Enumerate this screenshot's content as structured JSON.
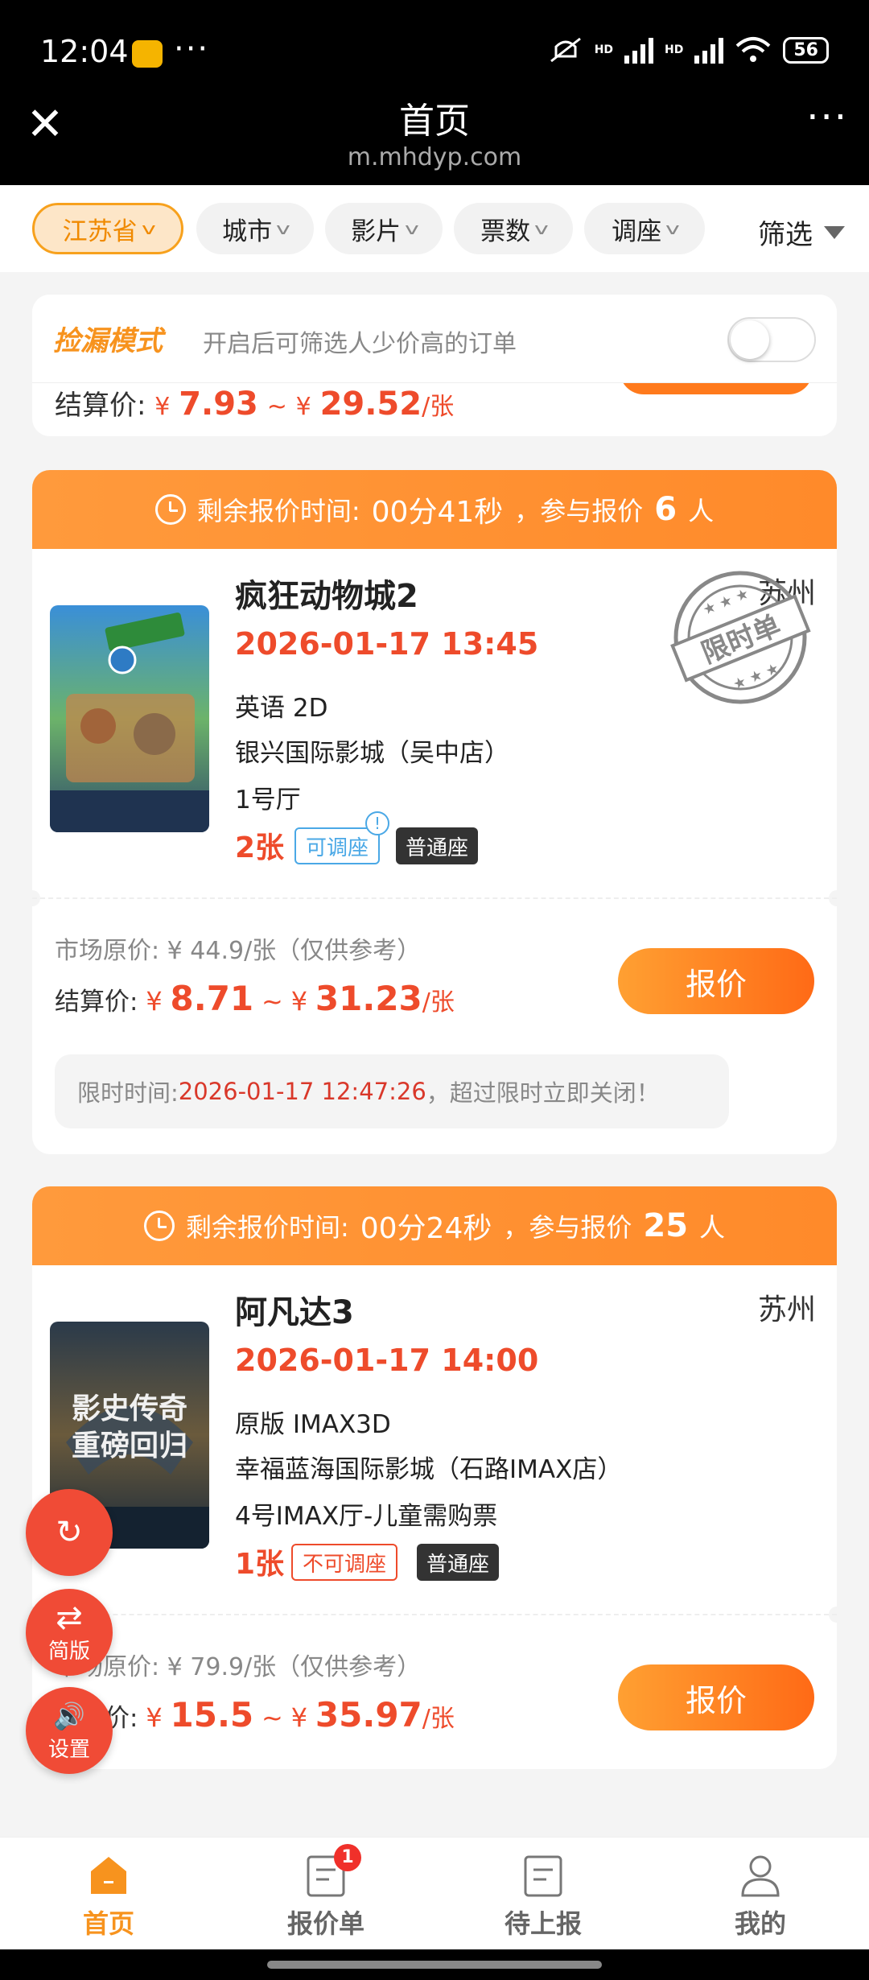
{
  "status_bar": {
    "time": "12:04",
    "more": "···",
    "battery": "56",
    "hd1": "HD",
    "hd2": "HD"
  },
  "header": {
    "title": "首页",
    "url": "m.mhdyp.com",
    "close": "✕",
    "more": "···"
  },
  "filters": {
    "chips": [
      {
        "label": "江苏省",
        "active": true
      },
      {
        "label": "城市",
        "active": false
      },
      {
        "label": "影片",
        "active": false
      },
      {
        "label": "票数",
        "active": false
      },
      {
        "label": "调座",
        "active": false
      }
    ],
    "filter_label": "筛选"
  },
  "mode": {
    "title": "捡漏模式",
    "desc": "开启后可筛选人少价高的订单",
    "enabled": false,
    "partial_settle_label": "结算价:",
    "partial_cur1": "¥",
    "partial_low": "7.93",
    "partial_sep": "~",
    "partial_cur2": "¥",
    "partial_high": "29.52",
    "partial_unit": "/张"
  },
  "orders": [
    {
      "remain_label": "剩余报价时间:",
      "remain_time": "00分41秒",
      "join_label": "，参与报价",
      "join_count": "6",
      "join_unit": "人",
      "title": "疯狂动物城2",
      "city": "苏州",
      "datetime": "2026-01-17 13:45",
      "format": "英语 2D",
      "cinema": "银兴国际影城（吴中店）",
      "hall": "1号厅",
      "count": "2张",
      "seat_tag": "可调座",
      "seat_tag_dot": "!",
      "seat_type": "普通座",
      "stamp_text": "限时单",
      "market_price": "市场原价: ¥ 44.9/张（仅供参考）",
      "settle_label": "结算价:",
      "cur1": "¥",
      "low": "8.71",
      "sep": "~",
      "cur2": "¥",
      "high": "31.23",
      "unit": "/张",
      "bid_label": "报价",
      "deadline_label": "限时时间:",
      "deadline_time": "2026-01-17 12:47:26",
      "deadline_suffix": "，超过限时立即关闭！"
    },
    {
      "remain_label": "剩余报价时间:",
      "remain_time": "00分24秒",
      "join_label": "，参与报价",
      "join_count": "25",
      "join_unit": "人",
      "title": "阿凡达3",
      "city": "苏州",
      "datetime": "2026-01-17 14:00",
      "format": "原版 IMAX3D",
      "cinema": "幸福蓝海国际影城（石路IMAX店）",
      "hall": "4号IMAX厅-儿童需购票",
      "count": "1张",
      "seat_tag": "不可调座",
      "seat_type": "普通座",
      "market_price": "市场原价: ¥ 79.9/张（仅供参考）",
      "settle_label": "结算价:",
      "cur1": "¥",
      "low": "15.5",
      "sep": "~",
      "cur2": "¥",
      "high": "35.97",
      "unit": "/张",
      "bid_label": "报价",
      "poster_text": "影史传奇重磅回归"
    }
  ],
  "fabs": [
    {
      "glyph": "↻",
      "label": ""
    },
    {
      "glyph": "⇄",
      "label": "简版"
    },
    {
      "glyph": "🔊",
      "label": "设置"
    }
  ],
  "tabbar": [
    {
      "label": "首页",
      "active": true
    },
    {
      "label": "报价单",
      "badge": "1"
    },
    {
      "label": "待上报"
    },
    {
      "label": "我的"
    }
  ],
  "colors": {
    "accent": "#f7931e",
    "price_red": "#ee4b2b",
    "head_orange": "#ff9a3c"
  }
}
